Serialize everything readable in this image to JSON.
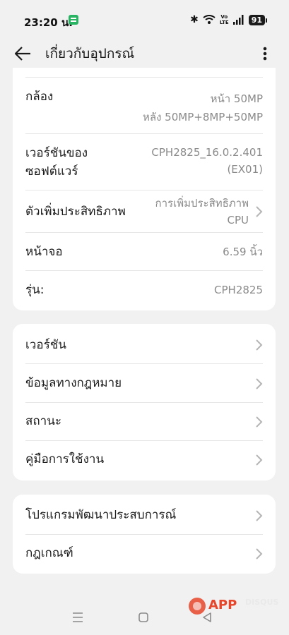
{
  "status": {
    "time": "23:20 น.",
    "volte_top": "Vo",
    "volte_bottom": "LTE",
    "battery": "91"
  },
  "header": {
    "title": "เกี่ยวกับอุปกรณ์"
  },
  "specs": {
    "camera_label": "กล้อง",
    "camera_front": "หน้า 50MP",
    "camera_rear": "หลัง 50MP+8MP+50MP",
    "software_label_1": "เวอร์ชันของ",
    "software_label_2": "ซอฟต์แวร์",
    "software_value_1": "CPH2825_16.0.2.401",
    "software_value_2": "(EX01)",
    "booster_label": "ตัวเพิ่มประสิทธิภาพ",
    "booster_value_1": "การเพิ่มประสิทธิภาพ",
    "booster_value_2": "CPU",
    "screen_label": "หน้าจอ",
    "screen_value": "6.59 นิ้ว",
    "model_label": "รุ่น:",
    "model_value": "CPH2825"
  },
  "info": {
    "items": [
      {
        "label": "เวอร์ชัน"
      },
      {
        "label": "ข้อมูลทางกฎหมาย"
      },
      {
        "label": "สถานะ"
      },
      {
        "label": "คู่มือการใช้งาน"
      }
    ]
  },
  "program": {
    "items": [
      {
        "label": "โปรแกรมพัฒนาประสบการณ์"
      },
      {
        "label": "กฎเกณฑ์"
      }
    ]
  },
  "watermark": {
    "brand": "APP",
    "suffix": "DISQUS"
  },
  "colors": {
    "background": "#f1f1f1",
    "card": "#ffffff",
    "secondary_text": "#8a8a8a",
    "watermark": "#e8462a"
  },
  "icons": {
    "back": "arrow-left-icon",
    "menu": "more-vertical-icon",
    "chevron": "chevron-right-icon"
  }
}
